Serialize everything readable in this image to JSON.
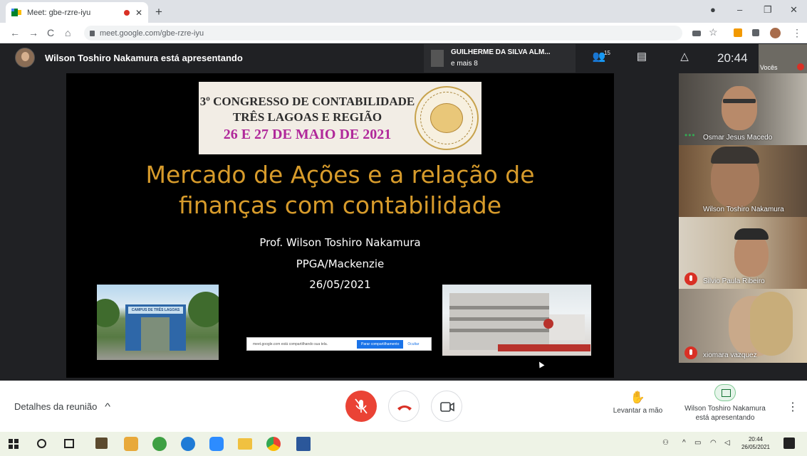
{
  "browser": {
    "tab_title": "Meet: gbe-rzre-iyu",
    "tab_close": "✕",
    "new_tab": "+",
    "url": "meet.google.com/gbe-rzre-iyu",
    "win_min": "–",
    "win_max": "❐",
    "win_close": "✕",
    "nav_back": "←",
    "nav_forward": "→",
    "nav_reload": "C",
    "nav_home": "⌂",
    "star": "☆",
    "menu": "⋮"
  },
  "meet": {
    "presenting_title": "Wilson Toshiro Nakamura está apresentando",
    "speaker_name": "GUILHERME DA SILVA ALM...",
    "speaker_more": "e mais 8",
    "participants_count": "15",
    "time": "20:44",
    "self_label": "Vocês",
    "icons": {
      "people": "people-icon",
      "chat": "chat-icon",
      "activities": "activities-icon"
    }
  },
  "slide": {
    "banner_line1": "3º CONGRESSO DE CONTABILIDADE",
    "banner_line2": "TRÊS LAGOAS E REGIÃO",
    "banner_line3": "26 E 27 DE MAIO DE 2021",
    "title_line1": "Mercado de Ações e a relação de",
    "title_line2": "finanças com contabilidade",
    "presenter": "Prof. Wilson Toshiro Nakamura",
    "affiliation": "PPGA/Mackenzie",
    "date": "26/05/2021",
    "left_photo_sign": "CAMPUS DE TRÊS LAGOAS"
  },
  "share_notice": {
    "text": "meet.google.com está compartilhando sua tela.",
    "stop": "Parar compartilhamento",
    "hide": "Ocultar"
  },
  "participants": [
    {
      "name": "Osmar Jesus Macedo",
      "muted": false
    },
    {
      "name": "Wilson Toshiro Nakamura",
      "muted": false
    },
    {
      "name": "Silvio Paula Ribeiro",
      "muted": true
    },
    {
      "name": "xiomara vazquez",
      "muted": true
    }
  ],
  "bottom": {
    "details": "Detalhes da reunião",
    "details_chevron": "^",
    "raise_hand": "Levantar a mão",
    "presenting_line1": "Wilson Toshiro Nakamura",
    "presenting_line2": "está apresentando"
  },
  "taskbar": {
    "time": "20:44",
    "date": "26/05/2021",
    "tray_arrow": "^"
  },
  "colors": {
    "accent_red": "#d93025",
    "slide_title": "#d79b2b",
    "banner_date": "#b0289a"
  }
}
